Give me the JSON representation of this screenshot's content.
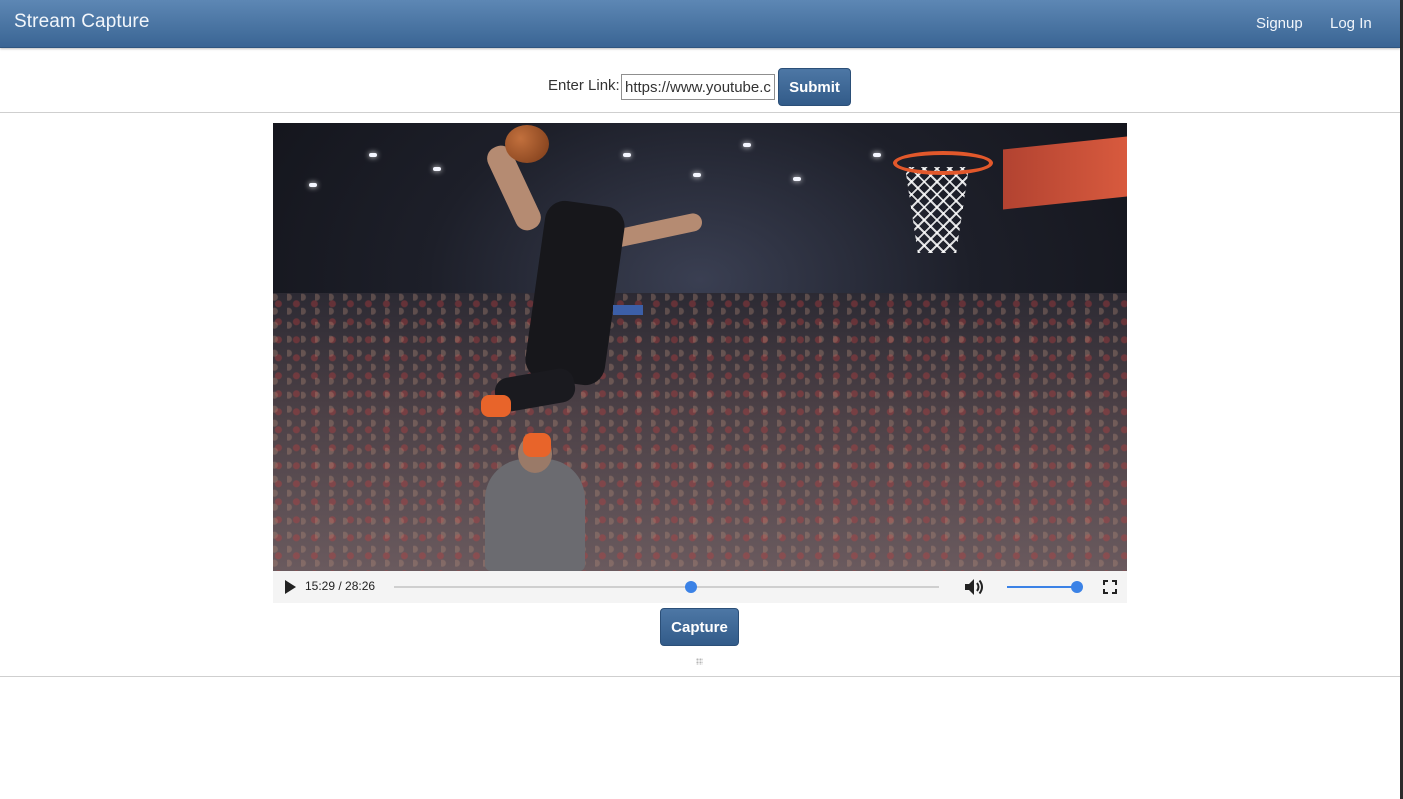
{
  "navbar": {
    "brand": "Stream Capture",
    "links": [
      {
        "label": "Signup"
      },
      {
        "label": "Log In"
      }
    ]
  },
  "link_form": {
    "label": "Enter Link:",
    "value": "https://www.youtube.com",
    "submit_label": "Submit"
  },
  "video": {
    "time_display": "15:29 / 28:26",
    "progress_fraction": 0.545,
    "volume_fraction": 1.0,
    "icons": {
      "play": "play-icon",
      "volume": "volume-icon",
      "fullscreen": "fullscreen-icon"
    }
  },
  "capture": {
    "label": "Capture"
  },
  "colors": {
    "navbar": "#4a74a3",
    "button": "#3f6895",
    "slider_accent": "#3b82e6"
  }
}
